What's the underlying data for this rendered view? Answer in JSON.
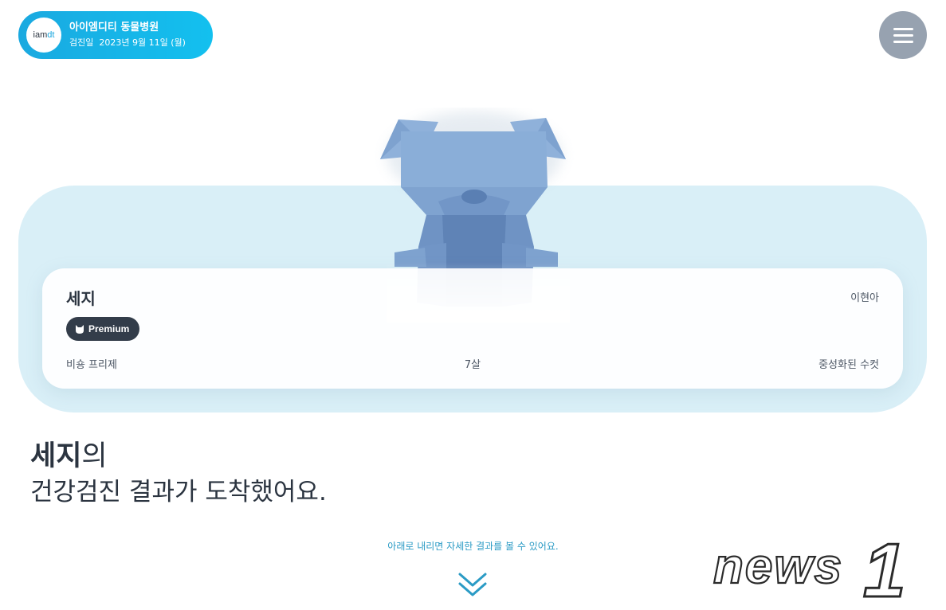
{
  "header": {
    "logo_text_main": "iam",
    "logo_text_accent": "dt",
    "hospital_name": "아이엠디티 동물병원",
    "exam_date_label": "검진일",
    "exam_date": "2023년 9월 11일 (월)"
  },
  "menu": {
    "icon": "hamburger-icon"
  },
  "pet_card": {
    "name": "세지",
    "owner": "이현아",
    "badge_icon": "cat-icon",
    "badge_label": "Premium",
    "breed": "비숑 프리제",
    "age": "7살",
    "sex": "중성화된 수컷"
  },
  "headline": {
    "pet_name": "세지",
    "suffix": "의",
    "message": "건강검진 결과가 도착했어요."
  },
  "scroll_hint": "아래로 내리면 자세한 결과를 볼 수 있어요.",
  "watermark": {
    "text": "news",
    "number": "1"
  },
  "colors": {
    "accent": "#13c0ef",
    "hero_bg": "#d9eff7",
    "badge_bg": "#333d4a",
    "text_dark": "#2b3440",
    "hint_blue": "#2b9bc5",
    "menu_gray": "#97a2b0",
    "dog_blue": "#7fa6d3"
  }
}
